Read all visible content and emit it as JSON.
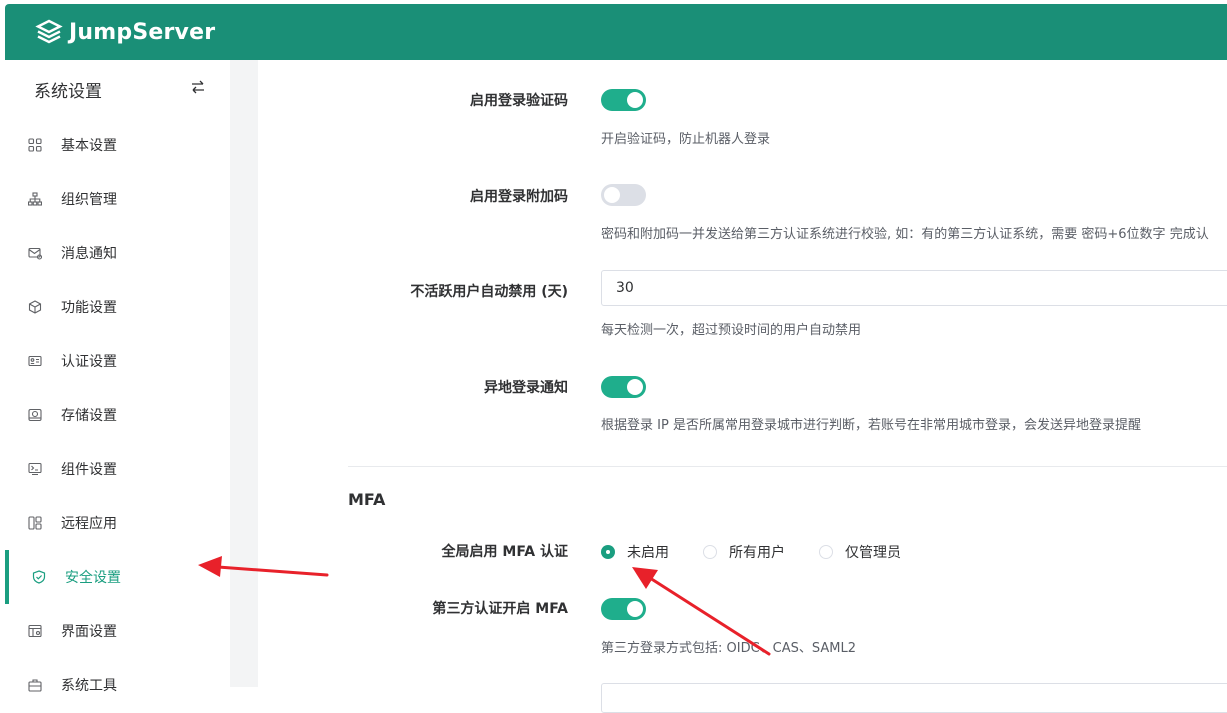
{
  "app": {
    "name": "JumpServer"
  },
  "sidebar": {
    "title": "系统设置",
    "items": [
      {
        "label": "基本设置",
        "icon": "grid-icon"
      },
      {
        "label": "组织管理",
        "icon": "org-tree-icon"
      },
      {
        "label": "消息通知",
        "icon": "mail-icon"
      },
      {
        "label": "功能设置",
        "icon": "cube-icon"
      },
      {
        "label": "认证设置",
        "icon": "id-card-icon"
      },
      {
        "label": "存储设置",
        "icon": "storage-icon"
      },
      {
        "label": "组件设置",
        "icon": "terminal-icon"
      },
      {
        "label": "远程应用",
        "icon": "apps-icon"
      },
      {
        "label": "安全设置",
        "icon": "shield-icon",
        "active": true
      },
      {
        "label": "界面设置",
        "icon": "window-icon"
      },
      {
        "label": "系统工具",
        "icon": "toolbox-icon"
      }
    ]
  },
  "settings": {
    "login_captcha": {
      "label": "启用登录验证码",
      "enabled": true,
      "help": "开启验证码，防止机器人登录"
    },
    "login_extra_code": {
      "label": "启用登录附加码",
      "enabled": false,
      "help": "密码和附加码一并发送给第三方认证系统进行校验, 如：有的第三方认证系统，需要 密码+6位数字 完成认"
    },
    "inactive_disable": {
      "label": "不活跃用户自动禁用 (天)",
      "value": "30",
      "help": "每天检测一次，超过预设时间的用户自动禁用"
    },
    "remote_login_notify": {
      "label": "异地登录通知",
      "enabled": true,
      "help": "根据登录 IP 是否所属常用登录城市进行判断，若账号在非常用城市登录，会发送异地登录提醒"
    }
  },
  "mfa": {
    "section_title": "MFA",
    "global_label": "全局启用 MFA 认证",
    "options": [
      "未启用",
      "所有用户",
      "仅管理员"
    ],
    "selected": "未启用",
    "third_party_label": "第三方认证开启 MFA",
    "third_party_enabled": true,
    "third_party_help": "第三方登录方式包括: OIDC、CAS、SAML2"
  },
  "colors": {
    "brand": "#1a8f77",
    "accent": "#1a9e80",
    "annotation_arrow": "#e8212a"
  }
}
